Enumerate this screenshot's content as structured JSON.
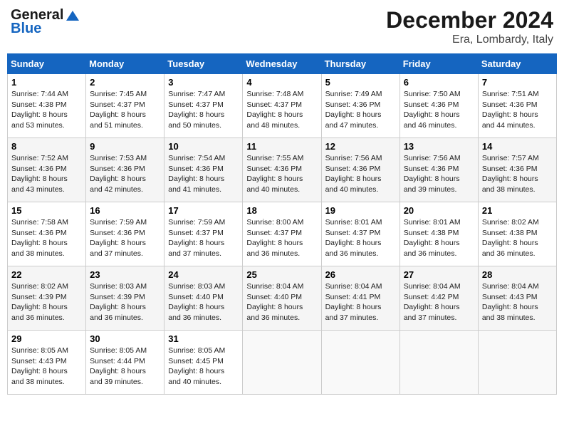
{
  "header": {
    "logo_line1": "General",
    "logo_line2": "Blue",
    "month": "December 2024",
    "location": "Era, Lombardy, Italy"
  },
  "days_of_week": [
    "Sunday",
    "Monday",
    "Tuesday",
    "Wednesday",
    "Thursday",
    "Friday",
    "Saturday"
  ],
  "weeks": [
    [
      {
        "day": "1",
        "info": "Sunrise: 7:44 AM\nSunset: 4:38 PM\nDaylight: 8 hours\nand 53 minutes."
      },
      {
        "day": "2",
        "info": "Sunrise: 7:45 AM\nSunset: 4:37 PM\nDaylight: 8 hours\nand 51 minutes."
      },
      {
        "day": "3",
        "info": "Sunrise: 7:47 AM\nSunset: 4:37 PM\nDaylight: 8 hours\nand 50 minutes."
      },
      {
        "day": "4",
        "info": "Sunrise: 7:48 AM\nSunset: 4:37 PM\nDaylight: 8 hours\nand 48 minutes."
      },
      {
        "day": "5",
        "info": "Sunrise: 7:49 AM\nSunset: 4:36 PM\nDaylight: 8 hours\nand 47 minutes."
      },
      {
        "day": "6",
        "info": "Sunrise: 7:50 AM\nSunset: 4:36 PM\nDaylight: 8 hours\nand 46 minutes."
      },
      {
        "day": "7",
        "info": "Sunrise: 7:51 AM\nSunset: 4:36 PM\nDaylight: 8 hours\nand 44 minutes."
      }
    ],
    [
      {
        "day": "8",
        "info": "Sunrise: 7:52 AM\nSunset: 4:36 PM\nDaylight: 8 hours\nand 43 minutes."
      },
      {
        "day": "9",
        "info": "Sunrise: 7:53 AM\nSunset: 4:36 PM\nDaylight: 8 hours\nand 42 minutes."
      },
      {
        "day": "10",
        "info": "Sunrise: 7:54 AM\nSunset: 4:36 PM\nDaylight: 8 hours\nand 41 minutes."
      },
      {
        "day": "11",
        "info": "Sunrise: 7:55 AM\nSunset: 4:36 PM\nDaylight: 8 hours\nand 40 minutes."
      },
      {
        "day": "12",
        "info": "Sunrise: 7:56 AM\nSunset: 4:36 PM\nDaylight: 8 hours\nand 40 minutes."
      },
      {
        "day": "13",
        "info": "Sunrise: 7:56 AM\nSunset: 4:36 PM\nDaylight: 8 hours\nand 39 minutes."
      },
      {
        "day": "14",
        "info": "Sunrise: 7:57 AM\nSunset: 4:36 PM\nDaylight: 8 hours\nand 38 minutes."
      }
    ],
    [
      {
        "day": "15",
        "info": "Sunrise: 7:58 AM\nSunset: 4:36 PM\nDaylight: 8 hours\nand 38 minutes."
      },
      {
        "day": "16",
        "info": "Sunrise: 7:59 AM\nSunset: 4:36 PM\nDaylight: 8 hours\nand 37 minutes."
      },
      {
        "day": "17",
        "info": "Sunrise: 7:59 AM\nSunset: 4:37 PM\nDaylight: 8 hours\nand 37 minutes."
      },
      {
        "day": "18",
        "info": "Sunrise: 8:00 AM\nSunset: 4:37 PM\nDaylight: 8 hours\nand 36 minutes."
      },
      {
        "day": "19",
        "info": "Sunrise: 8:01 AM\nSunset: 4:37 PM\nDaylight: 8 hours\nand 36 minutes."
      },
      {
        "day": "20",
        "info": "Sunrise: 8:01 AM\nSunset: 4:38 PM\nDaylight: 8 hours\nand 36 minutes."
      },
      {
        "day": "21",
        "info": "Sunrise: 8:02 AM\nSunset: 4:38 PM\nDaylight: 8 hours\nand 36 minutes."
      }
    ],
    [
      {
        "day": "22",
        "info": "Sunrise: 8:02 AM\nSunset: 4:39 PM\nDaylight: 8 hours\nand 36 minutes."
      },
      {
        "day": "23",
        "info": "Sunrise: 8:03 AM\nSunset: 4:39 PM\nDaylight: 8 hours\nand 36 minutes."
      },
      {
        "day": "24",
        "info": "Sunrise: 8:03 AM\nSunset: 4:40 PM\nDaylight: 8 hours\nand 36 minutes."
      },
      {
        "day": "25",
        "info": "Sunrise: 8:04 AM\nSunset: 4:40 PM\nDaylight: 8 hours\nand 36 minutes."
      },
      {
        "day": "26",
        "info": "Sunrise: 8:04 AM\nSunset: 4:41 PM\nDaylight: 8 hours\nand 37 minutes."
      },
      {
        "day": "27",
        "info": "Sunrise: 8:04 AM\nSunset: 4:42 PM\nDaylight: 8 hours\nand 37 minutes."
      },
      {
        "day": "28",
        "info": "Sunrise: 8:04 AM\nSunset: 4:43 PM\nDaylight: 8 hours\nand 38 minutes."
      }
    ],
    [
      {
        "day": "29",
        "info": "Sunrise: 8:05 AM\nSunset: 4:43 PM\nDaylight: 8 hours\nand 38 minutes."
      },
      {
        "day": "30",
        "info": "Sunrise: 8:05 AM\nSunset: 4:44 PM\nDaylight: 8 hours\nand 39 minutes."
      },
      {
        "day": "31",
        "info": "Sunrise: 8:05 AM\nSunset: 4:45 PM\nDaylight: 8 hours\nand 40 minutes."
      },
      null,
      null,
      null,
      null
    ]
  ]
}
